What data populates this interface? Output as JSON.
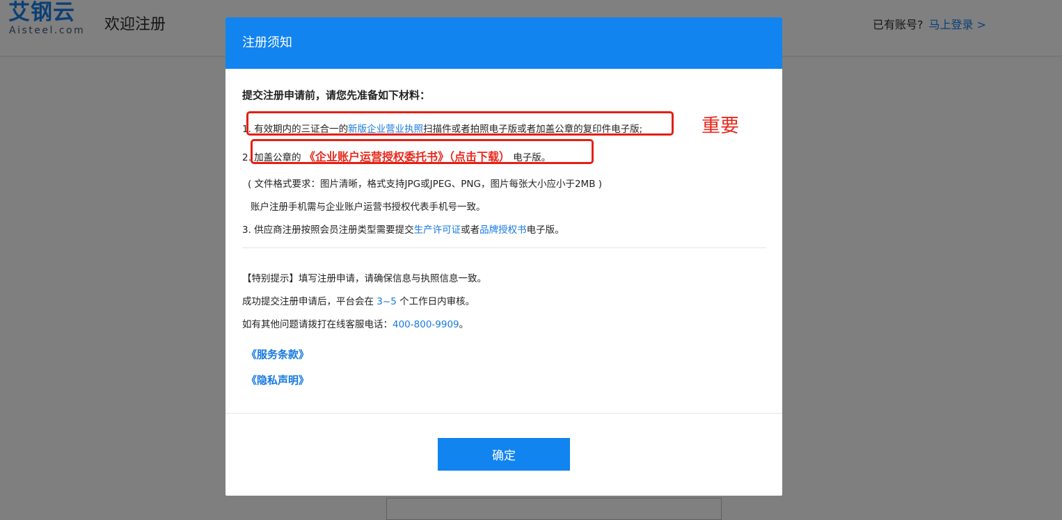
{
  "header": {
    "logo_cn": "艾钢云",
    "logo_en": "Aisteel.com",
    "welcome": "欢迎注册",
    "has_account": "已有账号?",
    "login_link": "马上登录 >"
  },
  "modal": {
    "title": "注册须知",
    "intro": "提交注册申请前，请您先准备如下材料：",
    "item1": {
      "prefix": "1. 有效期内的三证合一的",
      "link": "新版企业营业执照",
      "suffix": "扫描件或者拍照电子版或者加盖公章的复印件电子版;"
    },
    "important_note": "重要",
    "item2": {
      "prefix": "2. 加盖公章的",
      "link": "《企业账户运营授权委托书》（点击下载）",
      "suffix": "电子版。"
    },
    "format_note": "( 文件格式要求：图片清晰，格式支持JPG或JPEG、PNG，图片每张大小应小于2MB )",
    "phone_note": "账户注册手机需与企业账户运营书授权代表手机号一致。",
    "item3": {
      "prefix": "3. 供应商注册按照会员注册类型需要提交",
      "link1": "生产许可证",
      "middle": "或者",
      "link2": "品牌授权书",
      "suffix": "电子版。"
    },
    "tip1": "【特别提示】填写注册申请，请确保信息与执照信息一致。",
    "tip2": {
      "prefix": "成功提交注册申请后，平台会在 ",
      "days": "3~5",
      "suffix": " 个工作日内审核。"
    },
    "tip3": {
      "prefix": "如有其他问题请拨打在线客服电话：",
      "phone": "400-800-9909",
      "suffix": "。"
    },
    "terms_link": "《服务条款》",
    "privacy_link": "《隐私声明》",
    "confirm_button": "确定"
  },
  "colors": {
    "primary": "#1184ef",
    "link": "#1779e0",
    "highlight": "#e61e12",
    "overlay": "#7f7f7f"
  }
}
